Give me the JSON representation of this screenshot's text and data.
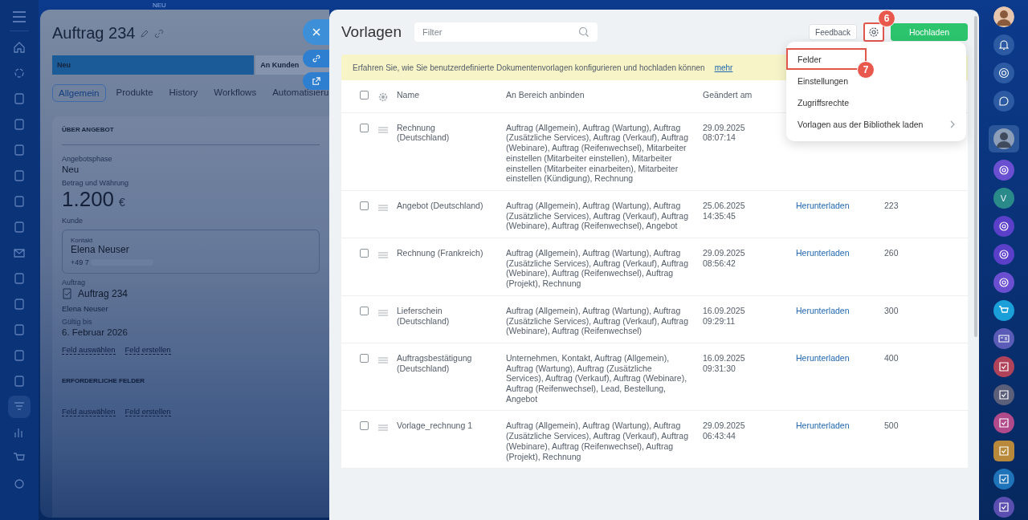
{
  "left_nav": {
    "items": [
      {
        "selected": false
      },
      {
        "selected": false
      },
      {
        "selected": false
      },
      {
        "selected": false
      },
      {
        "selected": false
      },
      {
        "selected": false
      },
      {
        "selected": false
      },
      {
        "selected": false
      },
      {
        "selected": false
      },
      {
        "selected": false
      },
      {
        "selected": false
      },
      {
        "selected": false
      },
      {
        "selected": false
      },
      {
        "selected": false
      },
      {
        "selected": true
      },
      {
        "selected": false
      },
      {
        "selected": false
      },
      {
        "selected": false
      }
    ]
  },
  "record": {
    "top_label": "NEU",
    "title": "Auftrag 234",
    "stages": [
      {
        "label": "Neu",
        "selected": true
      },
      {
        "label": "An Kunden",
        "selected": false
      }
    ],
    "tabs": [
      {
        "label": "Allgemein",
        "selected": true
      },
      {
        "label": "Produkte",
        "selected": false
      },
      {
        "label": "History",
        "selected": false
      },
      {
        "label": "Workflows",
        "selected": false
      },
      {
        "label": "Automatisieru",
        "selected": false
      }
    ],
    "section_title": "ÜBER ANGEBOT",
    "phase": {
      "label": "Angebotsphase",
      "value": "Neu"
    },
    "amount": {
      "label": "Betrag und Währung",
      "value": "1.200",
      "currency": "€"
    },
    "customer": {
      "label": "Kunde",
      "contact_label": "Kontakt",
      "name": "Elena Neuser",
      "phone": "+49 7"
    },
    "order": {
      "label": "Auftrag",
      "value": "Auftrag 234",
      "sub": "Elena Neuser"
    },
    "valid": {
      "label": "Gültig bis",
      "value": "6. Februar 2026"
    },
    "links": [
      "Feld auswählen",
      "Feld erstellen"
    ],
    "required_title": "ERFORDERLICHE FELDER",
    "required_links": [
      "Feld auswählen",
      "Feld erstellen"
    ]
  },
  "templates": {
    "title": "Vorlagen",
    "filter": {
      "placeholder": "Filter"
    },
    "feedback": "Feedback",
    "settings_badge": "6",
    "upload": "Hochladen",
    "banner": {
      "text": "Erfahren Sie, wie Sie benutzerdefinierte Dokumentenvorlagen konfigurieren und hochladen können",
      "link": "mehr"
    },
    "all_checked": false,
    "columns": [
      "Name",
      "An Bereich anbinden",
      "Geändert am"
    ],
    "rows": [
      {
        "checked": false,
        "name": "Rechnung (Deutschland)",
        "binding": "Auftrag (Allgemein), Auftrag (Wartung), Auftrag (Zusätzliche Services), Auftrag (Verkauf), Auftrag (Webinare), Auftrag (Reifenwechsel), Mitarbeiter einstellen (Mitarbeiter einstellen), Mitarbeiter einstellen (Mitarbeiter einarbeiten), Mitarbeiter einstellen (Kündigung), Rechnung",
        "date": "29.09.2025",
        "time": "08:07:14"
      },
      {
        "checked": false,
        "name": "Angebot (Deutschland)",
        "binding": "Auftrag (Allgemein), Auftrag (Wartung), Auftrag (Zusätzliche Services), Auftrag (Verkauf), Auftrag (Webinare), Auftrag (Reifenwechsel), Angebot",
        "date": "25.06.2025",
        "time": "14:35:45",
        "download": "Herunterladen",
        "number": "223"
      },
      {
        "checked": false,
        "name": "Rechnung (Frankreich)",
        "binding": "Auftrag (Allgemein), Auftrag (Wartung), Auftrag (Zusätzliche Services), Auftrag (Verkauf), Auftrag (Webinare), Auftrag (Reifenwechsel), Auftrag (Projekt), Rechnung",
        "date": "29.09.2025",
        "time": "08:56:42",
        "download": "Herunterladen",
        "number": "260"
      },
      {
        "checked": false,
        "name": "Lieferschein (Deutschland)",
        "binding": "Auftrag (Allgemein), Auftrag (Wartung), Auftrag (Zusätzliche Services), Auftrag (Verkauf), Auftrag (Webinare), Auftrag (Reifenwechsel)",
        "date": "16.09.2025",
        "time": "09:29:11",
        "download": "Herunterladen",
        "number": "300"
      },
      {
        "checked": false,
        "name": "Auftragsbestätigung (Deutschland)",
        "binding": "Unternehmen, Kontakt, Auftrag (Allgemein), Auftrag (Wartung), Auftrag (Zusätzliche Services), Auftrag (Verkauf), Auftrag (Webinare), Auftrag (Reifenwechsel), Lead, Bestellung, Angebot",
        "date": "16.09.2025",
        "time": "09:31:30",
        "download": "Herunterladen",
        "number": "400"
      },
      {
        "checked": false,
        "name": "Vorlage_rechnung 1",
        "binding": "Auftrag (Allgemein), Auftrag (Wartung), Auftrag (Zusätzliche Services), Auftrag (Verkauf), Auftrag (Webinare), Auftrag (Reifenwechsel), Auftrag (Projekt), Rechnung",
        "date": "29.09.2025",
        "time": "06:43:44",
        "download": "Herunterladen",
        "number": "500"
      }
    ]
  },
  "menu": {
    "badge": "7",
    "items": [
      {
        "label": "Felder",
        "marked": true,
        "submenu": false
      },
      {
        "label": "Einstellungen",
        "marked": false,
        "submenu": false
      },
      {
        "label": "Zugriffsrechte",
        "marked": false,
        "submenu": false
      },
      {
        "label": "Vorlagen aus der Bibliothek laden",
        "marked": false,
        "submenu": true
      }
    ]
  },
  "right_bar": {
    "items": [
      {
        "kind": "avatar"
      },
      {
        "kind": "bell"
      },
      {
        "kind": "ring"
      },
      {
        "kind": "chat"
      },
      {
        "kind": "avatar-square"
      },
      {
        "kind": "app",
        "color": "#6b4fd1"
      },
      {
        "kind": "letter",
        "color": "#2a8a8a",
        "label": "V"
      },
      {
        "kind": "app",
        "color": "#5a3fc9"
      },
      {
        "kind": "app",
        "color": "#5a3fc9"
      },
      {
        "kind": "app",
        "color": "#6b4fd1"
      },
      {
        "kind": "cart",
        "color": "#1a9fd8"
      },
      {
        "kind": "card",
        "color": "#5a5cb8"
      },
      {
        "kind": "task",
        "color": "#b0435a"
      },
      {
        "kind": "task",
        "color": "#5c5f7a"
      },
      {
        "kind": "task",
        "color": "#b04a8a"
      },
      {
        "kind": "task-square",
        "color": "#b8893a"
      },
      {
        "kind": "task",
        "color": "#1f73b8"
      },
      {
        "kind": "task",
        "color": "#5a4fb0"
      }
    ]
  }
}
